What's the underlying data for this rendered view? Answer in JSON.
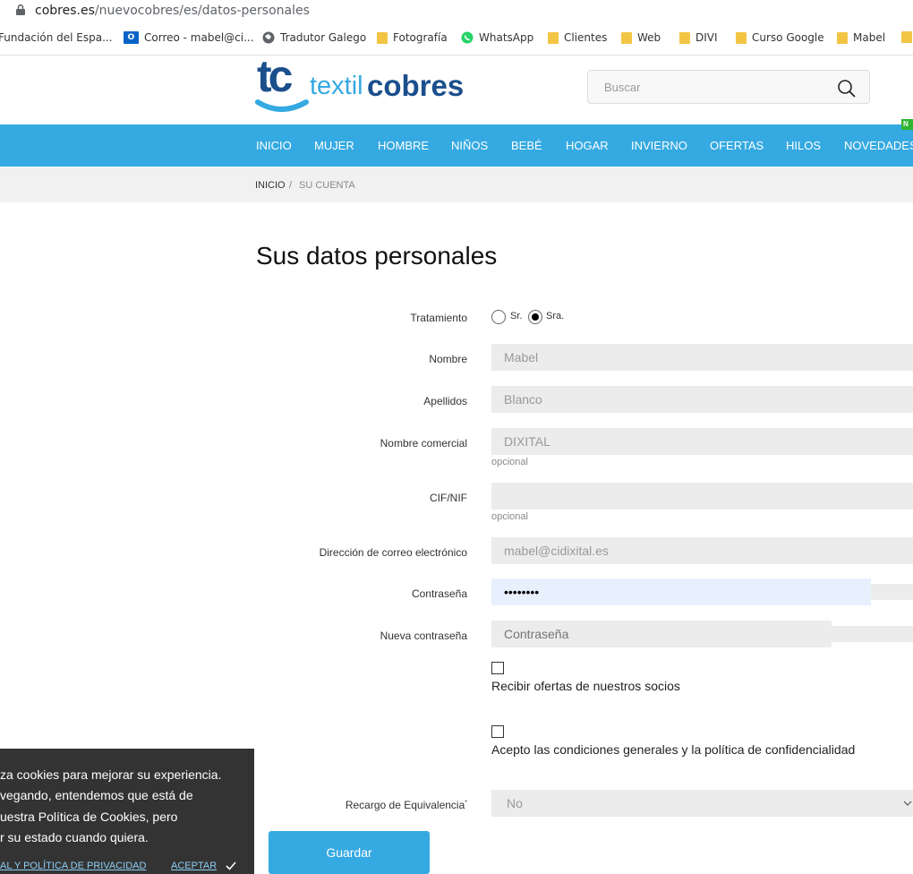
{
  "browser": {
    "url_domain": "cobres.es",
    "url_path": "/nuevocobres/es/datos-personales",
    "bookmarks": [
      {
        "label": "Fundación del Espa...",
        "icon": "bookmark-icon"
      },
      {
        "label": "Correo - mabel@ci...",
        "icon": "outlook-icon"
      },
      {
        "label": "Tradutor Galego",
        "icon": "globe-icon"
      },
      {
        "label": "Fotografía",
        "icon": "folder-icon"
      },
      {
        "label": "WhatsApp",
        "icon": "whatsapp-icon"
      },
      {
        "label": "Clientes",
        "icon": "folder-icon"
      },
      {
        "label": "Web",
        "icon": "folder-icon"
      },
      {
        "label": "DIVI",
        "icon": "folder-icon"
      },
      {
        "label": "Curso Google",
        "icon": "folder-icon"
      },
      {
        "label": "Mabel",
        "icon": "folder-icon"
      }
    ]
  },
  "header": {
    "logo_mark": "tc",
    "logo_text_light": "textil",
    "logo_text_bold": "cobres",
    "search_placeholder": "Buscar",
    "colors": {
      "brand_blue": "#35a9e1",
      "logo_dark": "#1b4f8c"
    }
  },
  "nav": {
    "items": [
      "INICIO",
      "MUJER",
      "HOMBRE",
      "NIÑOS",
      "BEBÉ",
      "HOGAR",
      "INVIERNO",
      "OFERTAS",
      "HILOS",
      "NOVEDADES"
    ],
    "badge": "N"
  },
  "breadcrumb": {
    "home": "INICIO",
    "separator": "/",
    "current": "SU CUENTA"
  },
  "page_title": "Sus datos personales",
  "form": {
    "tratamiento_label": "Tratamiento",
    "option_sr": "Sr.",
    "option_sra": "Sra.",
    "selected": "Sra.",
    "nombre_label": "Nombre",
    "nombre_value": "Mabel",
    "apellidos_label": "Apellidos",
    "apellidos_value": "Blanco",
    "comercial_label": "Nombre comercial",
    "comercial_value": "DIXITAL",
    "optional": "opcional",
    "cif_label": "CIF/NIF",
    "cif_value": "",
    "email_label": "Dirección de correo electrónico",
    "email_value": "mabel@cidixital.es",
    "password_label": "Contraseña",
    "password_value": "••••••••",
    "newpass_label": "Nueva contraseña",
    "newpass_placeholder": "Contraseña",
    "offers_label": "Recibir ofertas de nuestros socios",
    "terms_label": "Acepto las condiciones generales y la política de confidencialidad",
    "recargo_label": "Recargo de Equivalencia",
    "recargo_marker": "*",
    "recargo_value": "No",
    "save_label": "Guardar"
  },
  "cookie": {
    "line1": "za cookies para mejorar su experiencia.",
    "line2": "vegando, entendemos que está de",
    "line3": "uestra Política de Cookies, pero",
    "line4": "r su estado cuando quiera.",
    "policy_link": "AL Y POLÍTICA DE PRIVACIDAD",
    "accept_link": "ACEPTAR",
    "accept_icon": "check-icon"
  }
}
